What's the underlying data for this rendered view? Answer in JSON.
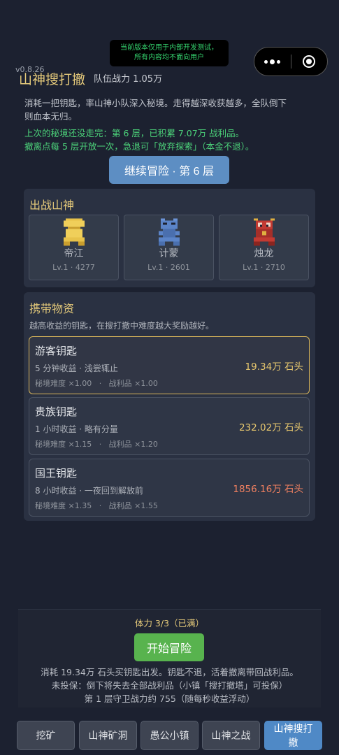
{
  "notice": {
    "line1": "当前版本仅用于内部开发测试，",
    "line2": "所有内容均不面向用户"
  },
  "capsule": {
    "more_icon": "more-dots-icon",
    "close_icon": "target-close-icon"
  },
  "version": "v0.8.26",
  "header": {
    "title": "山神搜打撤",
    "power": "队伍战力 1.05万"
  },
  "description": {
    "line1": "消耗一把钥匙，率山神小队深入秘境。走得越深收获越多，全队倒下",
    "line2": "则血本无归。"
  },
  "progress": {
    "line1": "上次的秘境还没走完：第 6 层，已积累 7.07万 战利品。",
    "line2": "撤离点每 5 层开放一次，急退可「放弃探索」（本金不退）。"
  },
  "continue_button": "继续冒险 · 第 6 层",
  "heroes_section": {
    "title": "出战山神",
    "heroes": [
      {
        "name": "帝江",
        "meta": "Lv.1 · 4277",
        "color": "#e7c24a",
        "icon": "dijiang-sprite-icon"
      },
      {
        "name": "计蒙",
        "meta": "Lv.1 · 2601",
        "color": "#5b84c8",
        "icon": "jimeng-sprite-icon"
      },
      {
        "name": "烛龙",
        "meta": "Lv.1 · 2710",
        "color": "#c23a32",
        "icon": "zhulong-sprite-icon"
      }
    ]
  },
  "items_section": {
    "title": "携带物资",
    "hint": "越高收益的钥匙，在搜打撤中难度越大奖励越好。",
    "keys": [
      {
        "name": "游客钥匙",
        "desc": "5 分钟收益 · 浅尝辄止",
        "multipliers": "秘境难度 ×1.00   ·   战利品 ×1.00",
        "value": "19.34万 石头"
      },
      {
        "name": "贵族钥匙",
        "desc": "1 小时收益 · 略有分量",
        "multipliers": "秘境难度 ×1.15   ·   战利品 ×1.20",
        "value": "232.02万 石头"
      },
      {
        "name": "国王钥匙",
        "desc": "8 小时收益 · 一夜回到解放前",
        "multipliers": "秘境难度 ×1.35   ·   战利品 ×1.55",
        "value": "1856.16万 石头"
      }
    ]
  },
  "footer": {
    "stamina": "体力 3/3（已满）",
    "start_button": "开始冒险",
    "info1": "消耗 19.34万 石头买钥匙出发。钥匙不退，活着撤离带回战利品。",
    "info2": "未投保：倒下将失去全部战利品（小镇「搜打撤塔」可投保）",
    "info3": "第 1 层守卫战力约 755（随每秒收益浮动）"
  },
  "tabs": [
    "挖矿",
    "山神矿洞",
    "愚公小镇",
    "山神之战",
    "山神搜打撤"
  ]
}
